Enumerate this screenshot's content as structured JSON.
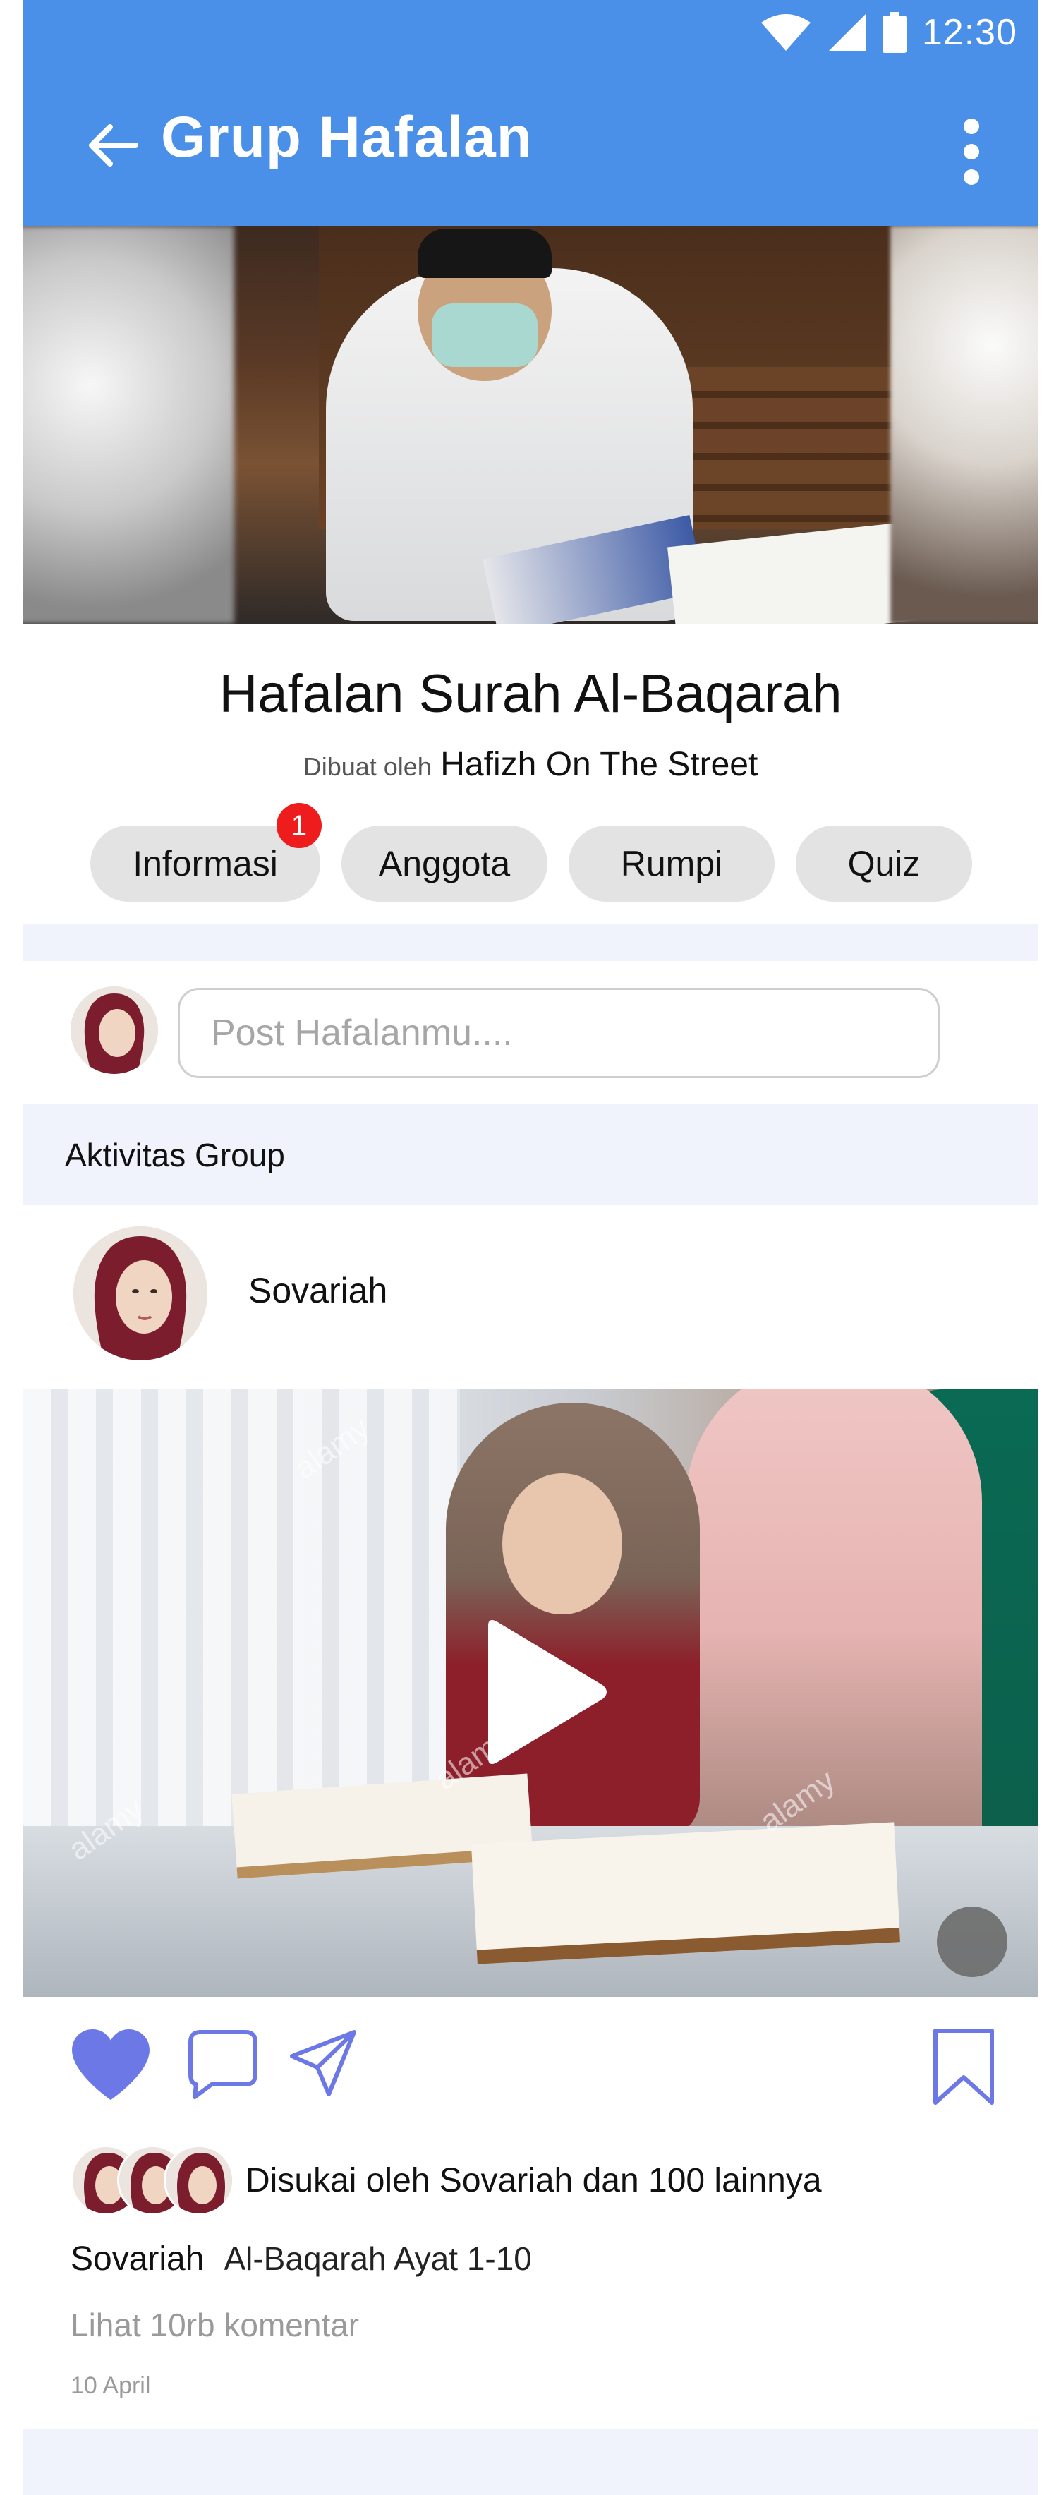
{
  "status_bar": {
    "time": "12:30"
  },
  "app_bar": {
    "title": "Grup Hafalan"
  },
  "group": {
    "name": "Hafalan Surah Al-Baqarah",
    "created_by_prefix": "Dibuat oleh",
    "created_by": "Hafizh On The Street"
  },
  "tabs": [
    {
      "label": "Informasi",
      "badge": "1"
    },
    {
      "label": "Anggota"
    },
    {
      "label": "Rumpi"
    },
    {
      "label": "Quiz"
    }
  ],
  "composer": {
    "placeholder": "Post Hafalanmu...."
  },
  "section": {
    "label": "Aktivitas Group"
  },
  "post": {
    "username": "Sovariah",
    "liked_by": "Disukai oleh Sovariah dan 100 lainnya",
    "caption_user": "Sovariah",
    "caption_text": "Al-Baqarah Ayat 1-10",
    "view_comments": "Lihat 10rb komentar",
    "date": "10 April",
    "watermark": "alamy"
  },
  "colors": {
    "app_bar": "#4a8fe8",
    "accent_icon": "#6b78e6",
    "badge": "#ee1c1c",
    "tab_bg": "#e3e3e3",
    "section_bg": "#f0f3fb"
  }
}
